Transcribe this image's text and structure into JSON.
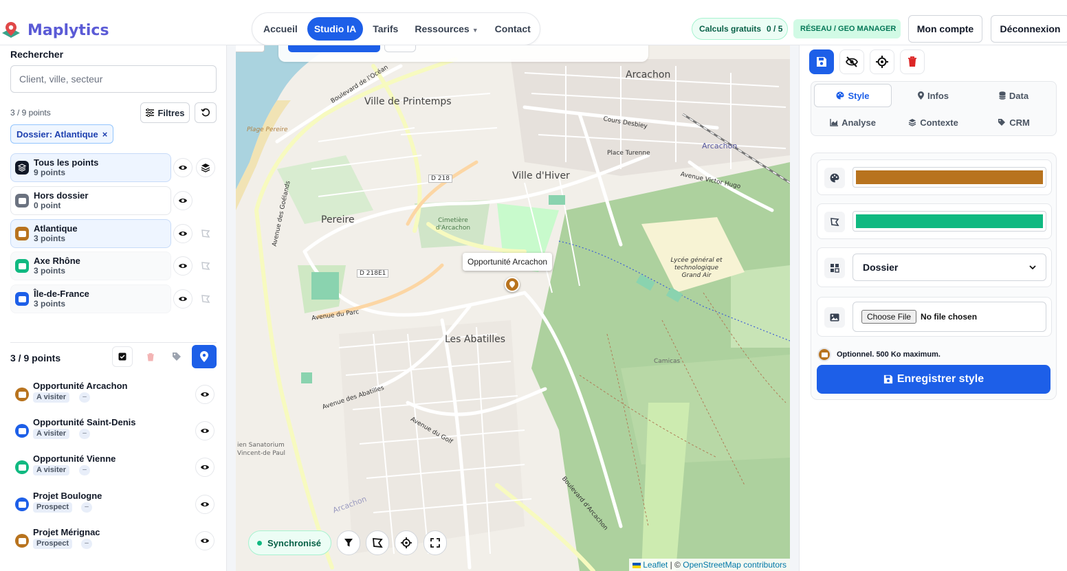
{
  "header": {
    "brand": "Maplytics",
    "nav": [
      {
        "label": "Accueil"
      },
      {
        "label": "Studio IA"
      },
      {
        "label": "Tarifs"
      },
      {
        "label": "Ressources"
      },
      {
        "label": "Contact"
      }
    ],
    "calc_label": "Calculs gratuits",
    "calc_value": "0 / 5",
    "role_badge": "RÉSEAU / GEO MANAGER",
    "account": "Mon compte",
    "logout": "Déconnexion"
  },
  "sidebar": {
    "search_label": "Rechercher",
    "search_placeholder": "Client, ville, secteur",
    "points_count": "3 / 9 points",
    "filters_label": "Filtres",
    "active_chip": "Dossier: Atlantique",
    "folders": [
      {
        "name": "Tous les points",
        "count": "9 points",
        "color": "#111827"
      },
      {
        "name": "Hors dossier",
        "count": "0 point",
        "color": "#6b7280"
      },
      {
        "name": "Atlantique",
        "count": "3 points",
        "color": "#b8731e"
      },
      {
        "name": "Axe Rhône",
        "count": "3 points",
        "color": "#10b981"
      },
      {
        "name": "Île-de-France",
        "count": "3 points",
        "color": "#1d5fe8"
      }
    ],
    "list_header": "3 / 9 points",
    "points": [
      {
        "name": "Opportunité Arcachon",
        "status": "A visiter",
        "extra": "–",
        "color": "#b8731e"
      },
      {
        "name": "Opportunité Saint-Denis",
        "status": "A visiter",
        "extra": "–",
        "color": "#1d5fe8"
      },
      {
        "name": "Opportunité Vienne",
        "status": "A visiter",
        "extra": "–",
        "color": "#10b981"
      },
      {
        "name": "Projet Boulogne",
        "status": "Prospect",
        "extra": "–",
        "color": "#1d5fe8"
      },
      {
        "name": "Projet Mérignac",
        "status": "Prospect",
        "extra": "–",
        "color": "#b8731e"
      }
    ]
  },
  "map": {
    "labels": {
      "arcachon": "Arcachon",
      "ville_printemps": "Ville de Printemps",
      "ville_hiver": "Ville d'Hiver",
      "pereire": "Pereire",
      "abatilles": "Les Abatilles",
      "place_turenne": "Place Turenne",
      "cimetiere": "Cimetière d'Arcachon",
      "lycee": "Lycée général et technologique Grand Air",
      "camicas": "Camicas",
      "sanatorium": "ien Sanatorium Vincent-de Paul",
      "plage": "Plage Pereire",
      "d218": "D 218",
      "d218e1": "D 218E1",
      "av_parc": "Avenue du Parc",
      "bd_ocean": "Boulevard de l'Océan",
      "bd_arcachon": "Boulevard d'Arcachon",
      "av_goelands": "Avenue des Goélands",
      "cours_desbiey": "Cours Desbiey",
      "av_victor_hugo": "Avenue Victor Hugo",
      "arcachon_station": "Arcachon",
      "arcachon_bottom": "Arcachon",
      "av_golf": "Avenue du Golf",
      "av_abatilles": "Avenue des Abatilles"
    },
    "tooltip": "Opportunité Arcachon",
    "sync": "Synchronisé",
    "attribution_leaflet": "Leaflet",
    "attribution_sep": "| ©",
    "attribution_osm": "OpenStreetMap contributors"
  },
  "panel": {
    "tabs": [
      {
        "label": "Style"
      },
      {
        "label": "Infos"
      },
      {
        "label": "Data"
      },
      {
        "label": "Analyse"
      },
      {
        "label": "Contexte"
      },
      {
        "label": "CRM"
      }
    ],
    "marker_color": "#b8731e",
    "zone_color": "#10b981",
    "folder_select": "Dossier",
    "file_button": "Choose File",
    "file_status": "No file chosen",
    "hint": "Optionnel. 500 Ko maximum.",
    "save": "Enregistrer style"
  }
}
